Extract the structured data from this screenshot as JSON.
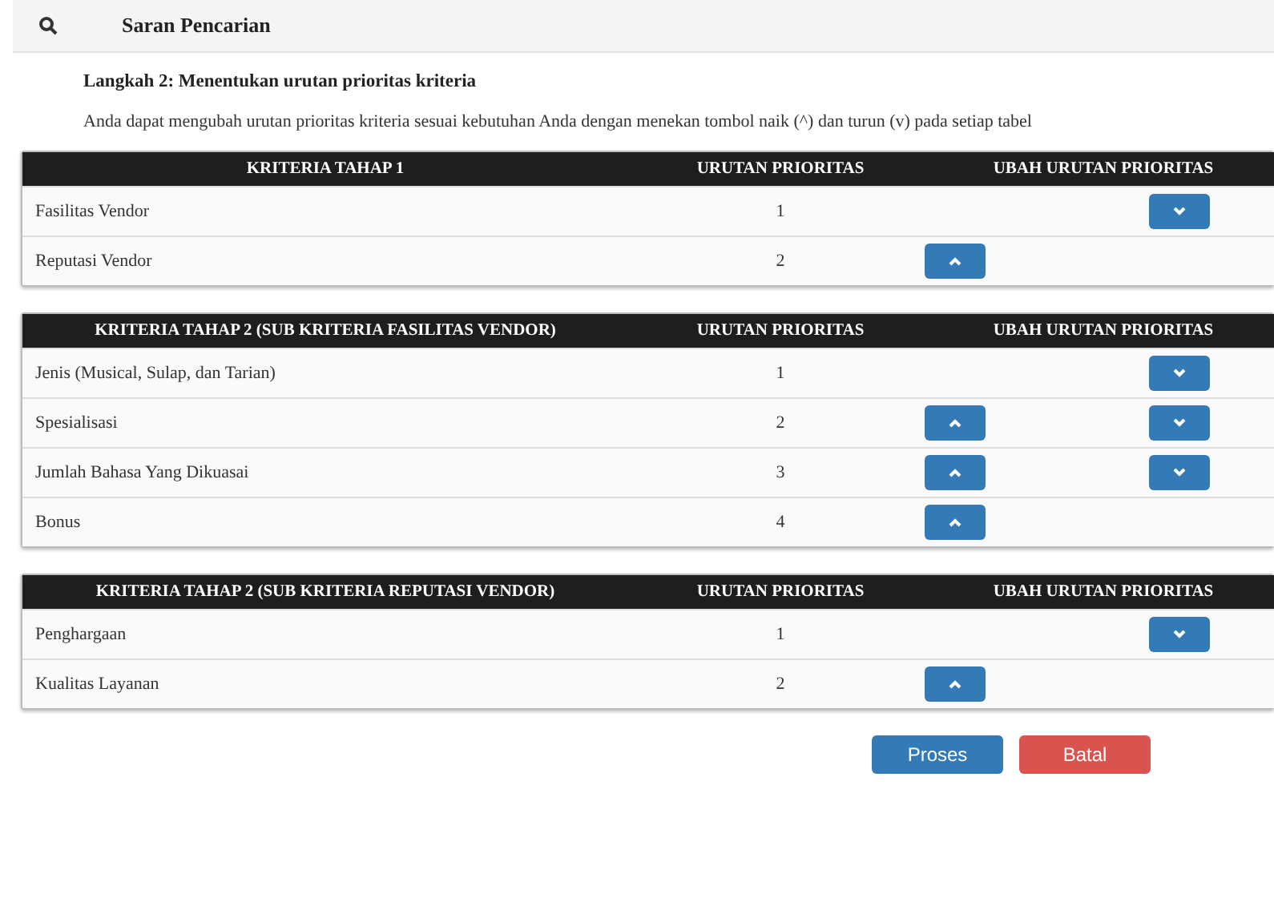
{
  "header": {
    "title": "Saran Pencarian"
  },
  "step_title": "Langkah 2: Menentukan urutan prioritas kriteria",
  "description": "Anda dapat mengubah urutan prioritas kriteria sesuai kebutuhan Anda dengan menekan tombol naik (^) dan turun (v) pada setiap tabel",
  "tables": [
    {
      "columns": [
        "KRITERIA TAHAP 1",
        "URUTAN PRIORITAS",
        "UBAH URUTAN PRIORITAS"
      ],
      "rows": [
        {
          "name": "Fasilitas Vendor",
          "priority": "1",
          "can_up": false,
          "can_down": true
        },
        {
          "name": "Reputasi Vendor",
          "priority": "2",
          "can_up": true,
          "can_down": false
        }
      ]
    },
    {
      "columns": [
        "KRITERIA TAHAP 2 (SUB KRITERIA FASILITAS VENDOR)",
        "URUTAN PRIORITAS",
        "UBAH URUTAN PRIORITAS"
      ],
      "rows": [
        {
          "name": "Jenis (Musical, Sulap, dan Tarian)",
          "priority": "1",
          "can_up": false,
          "can_down": true
        },
        {
          "name": "Spesialisasi",
          "priority": "2",
          "can_up": true,
          "can_down": true
        },
        {
          "name": "Jumlah Bahasa Yang Dikuasai",
          "priority": "3",
          "can_up": true,
          "can_down": true
        },
        {
          "name": "Bonus",
          "priority": "4",
          "can_up": true,
          "can_down": false
        }
      ]
    },
    {
      "columns": [
        "KRITERIA TAHAP 2 (SUB KRITERIA REPUTASI VENDOR)",
        "URUTAN PRIORITAS",
        "UBAH URUTAN PRIORITAS"
      ],
      "rows": [
        {
          "name": "Penghargaan",
          "priority": "1",
          "can_up": false,
          "can_down": true
        },
        {
          "name": "Kualitas Layanan",
          "priority": "2",
          "can_up": true,
          "can_down": false
        }
      ]
    }
  ],
  "buttons": [
    {
      "label": "Proses",
      "kind": "primary"
    },
    {
      "label": "Batal",
      "kind": "danger"
    }
  ]
}
